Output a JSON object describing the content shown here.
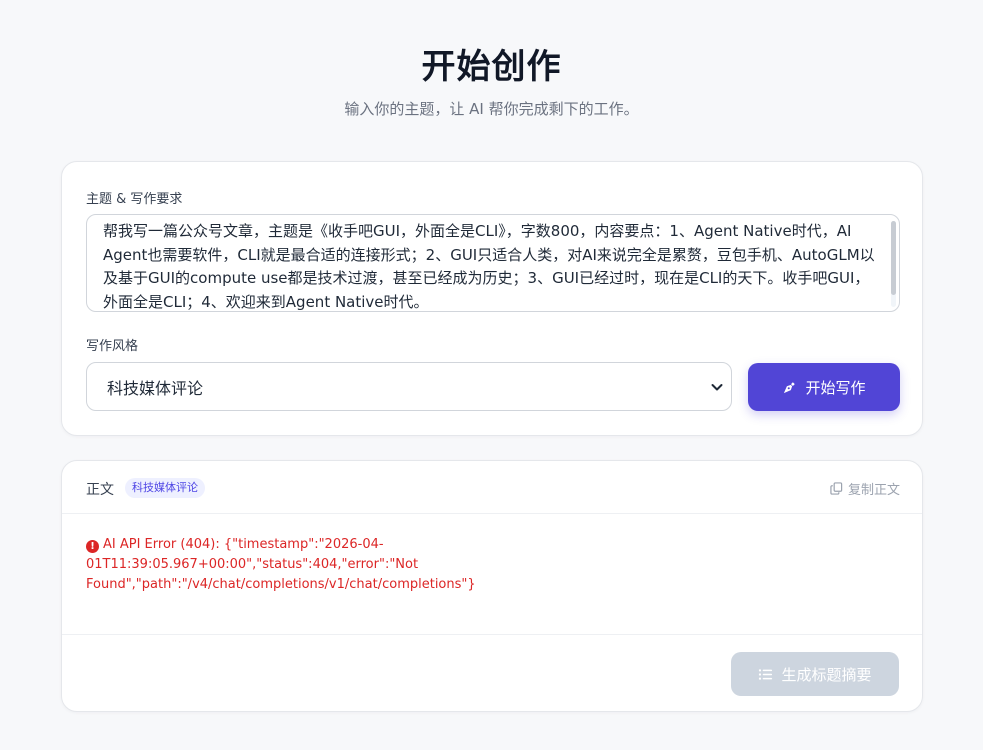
{
  "hero": {
    "title": "开始创作",
    "subtitle": "输入你的主题，让 AI 帮你完成剩下的工作。"
  },
  "input_card": {
    "topic_label": "主题 & 写作要求",
    "topic_value": "帮我写一篇公众号文章，主题是《收手吧GUI，外面全是CLI》，字数800，内容要点：1、Agent Native时代，AI Agent也需要软件，CLI就是最合适的连接形式；2、GUI只适合人类，对AI来说完全是累赘，豆包手机、AutoGLM以及基于GUI的compute use都是技术过渡，甚至已经成为历史；3、GUI已经过时，现在是CLI的天下。收手吧GUI，外面全是CLI；4、欢迎来到Agent Native时代。",
    "style_label": "写作风格",
    "style_selected": "科技媒体评论",
    "start_button": "开始写作"
  },
  "output_card": {
    "title": "正文",
    "style_badge": "科技媒体评论",
    "copy_button": "复制正文",
    "error_icon": "!",
    "error_message": "AI API Error (404): {\"timestamp\":\"2026-04-01T11:39:05.967+00:00\",\"status\":404,\"error\":\"Not Found\",\"path\":\"/v4/chat/completions/v1/chat/completions\"}",
    "summary_button": "生成标题摘要"
  },
  "icons": {
    "start": "pen-nib-icon",
    "copy": "copy-icon",
    "error": "error-circle-icon",
    "summary": "list-icon",
    "select": "chevron-down-icon"
  },
  "colors": {
    "primary": "#5145d6",
    "error": "#dc2626",
    "disabled": "#cdd5df",
    "badge_bg": "#eef0ff",
    "badge_text": "#4f46e5"
  }
}
